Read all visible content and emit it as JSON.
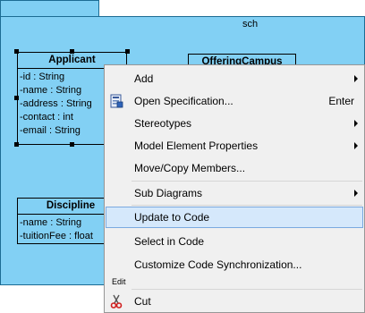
{
  "diagram": {
    "package_name": "sch",
    "classes": [
      {
        "name": "Applicant",
        "attributes": [
          "-id : String",
          "-name : String",
          "-address : String",
          "-contact : int",
          "-email : String"
        ]
      },
      {
        "name": "OfferingCampus",
        "attributes": []
      },
      {
        "name": "Discipline",
        "attributes": [
          "-name : String",
          "-tuitionFee : float"
        ]
      }
    ]
  },
  "context_menu": {
    "items": [
      {
        "label": "Add",
        "submenu": true
      },
      {
        "label": "Open Specification...",
        "shortcut": "Enter",
        "icon": "specification-icon"
      },
      {
        "label": "Stereotypes",
        "submenu": true
      },
      {
        "label": "Model Element Properties",
        "submenu": true
      },
      {
        "label": "Move/Copy Members..."
      },
      {
        "label": "Sub Diagrams",
        "submenu": true
      },
      {
        "label": "Update to Code",
        "highlighted": true
      },
      {
        "label": "Select in Code"
      },
      {
        "label": "Customize Code Synchronization..."
      },
      {
        "label": "Cut",
        "icon": "scissors-icon"
      }
    ],
    "group_edit_label": "Edit"
  },
  "colors": {
    "package_fill": "#82d0f4",
    "menu_bg": "#f0f0f0",
    "highlight": "#d5e8fb"
  }
}
